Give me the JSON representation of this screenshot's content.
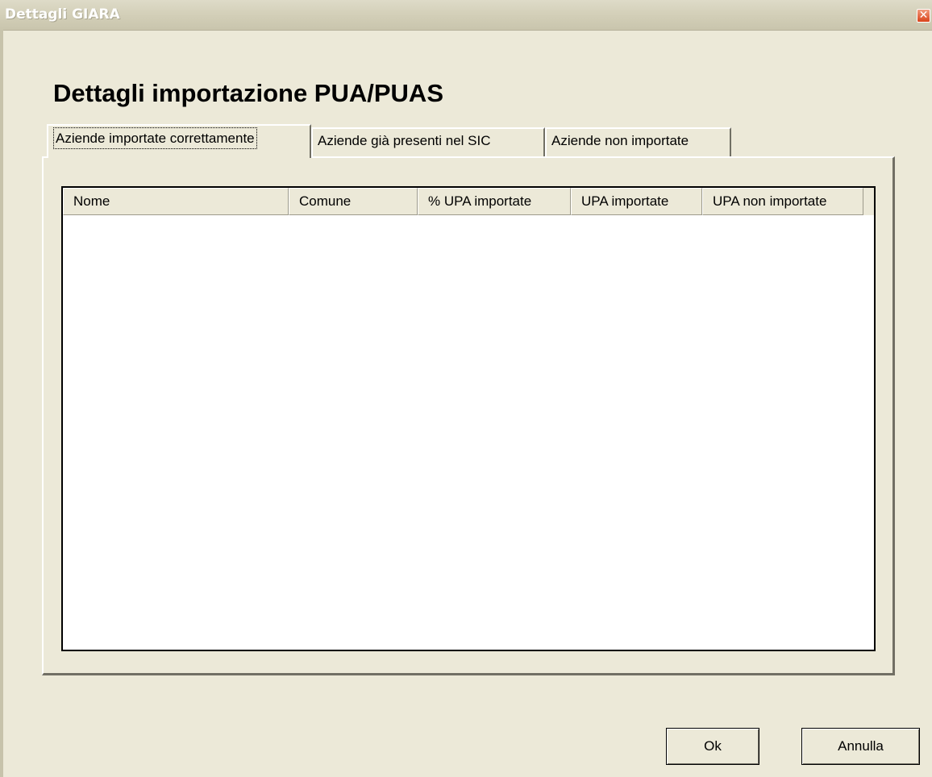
{
  "window": {
    "title": "Dettagli GIARA",
    "close_glyph": "✕"
  },
  "heading": "Dettagli importazione PUA/PUAS",
  "tabs": [
    {
      "label": "Aziende importate correttamente",
      "active": true
    },
    {
      "label": "Aziende già presenti nel SIC",
      "active": false
    },
    {
      "label": "Aziende non importate",
      "active": false
    }
  ],
  "table": {
    "columns": [
      "Nome",
      "Comune",
      "% UPA importate",
      "UPA importate",
      "UPA non importate"
    ],
    "rows": []
  },
  "buttons": {
    "ok": "Ok",
    "cancel": "Annulla"
  }
}
